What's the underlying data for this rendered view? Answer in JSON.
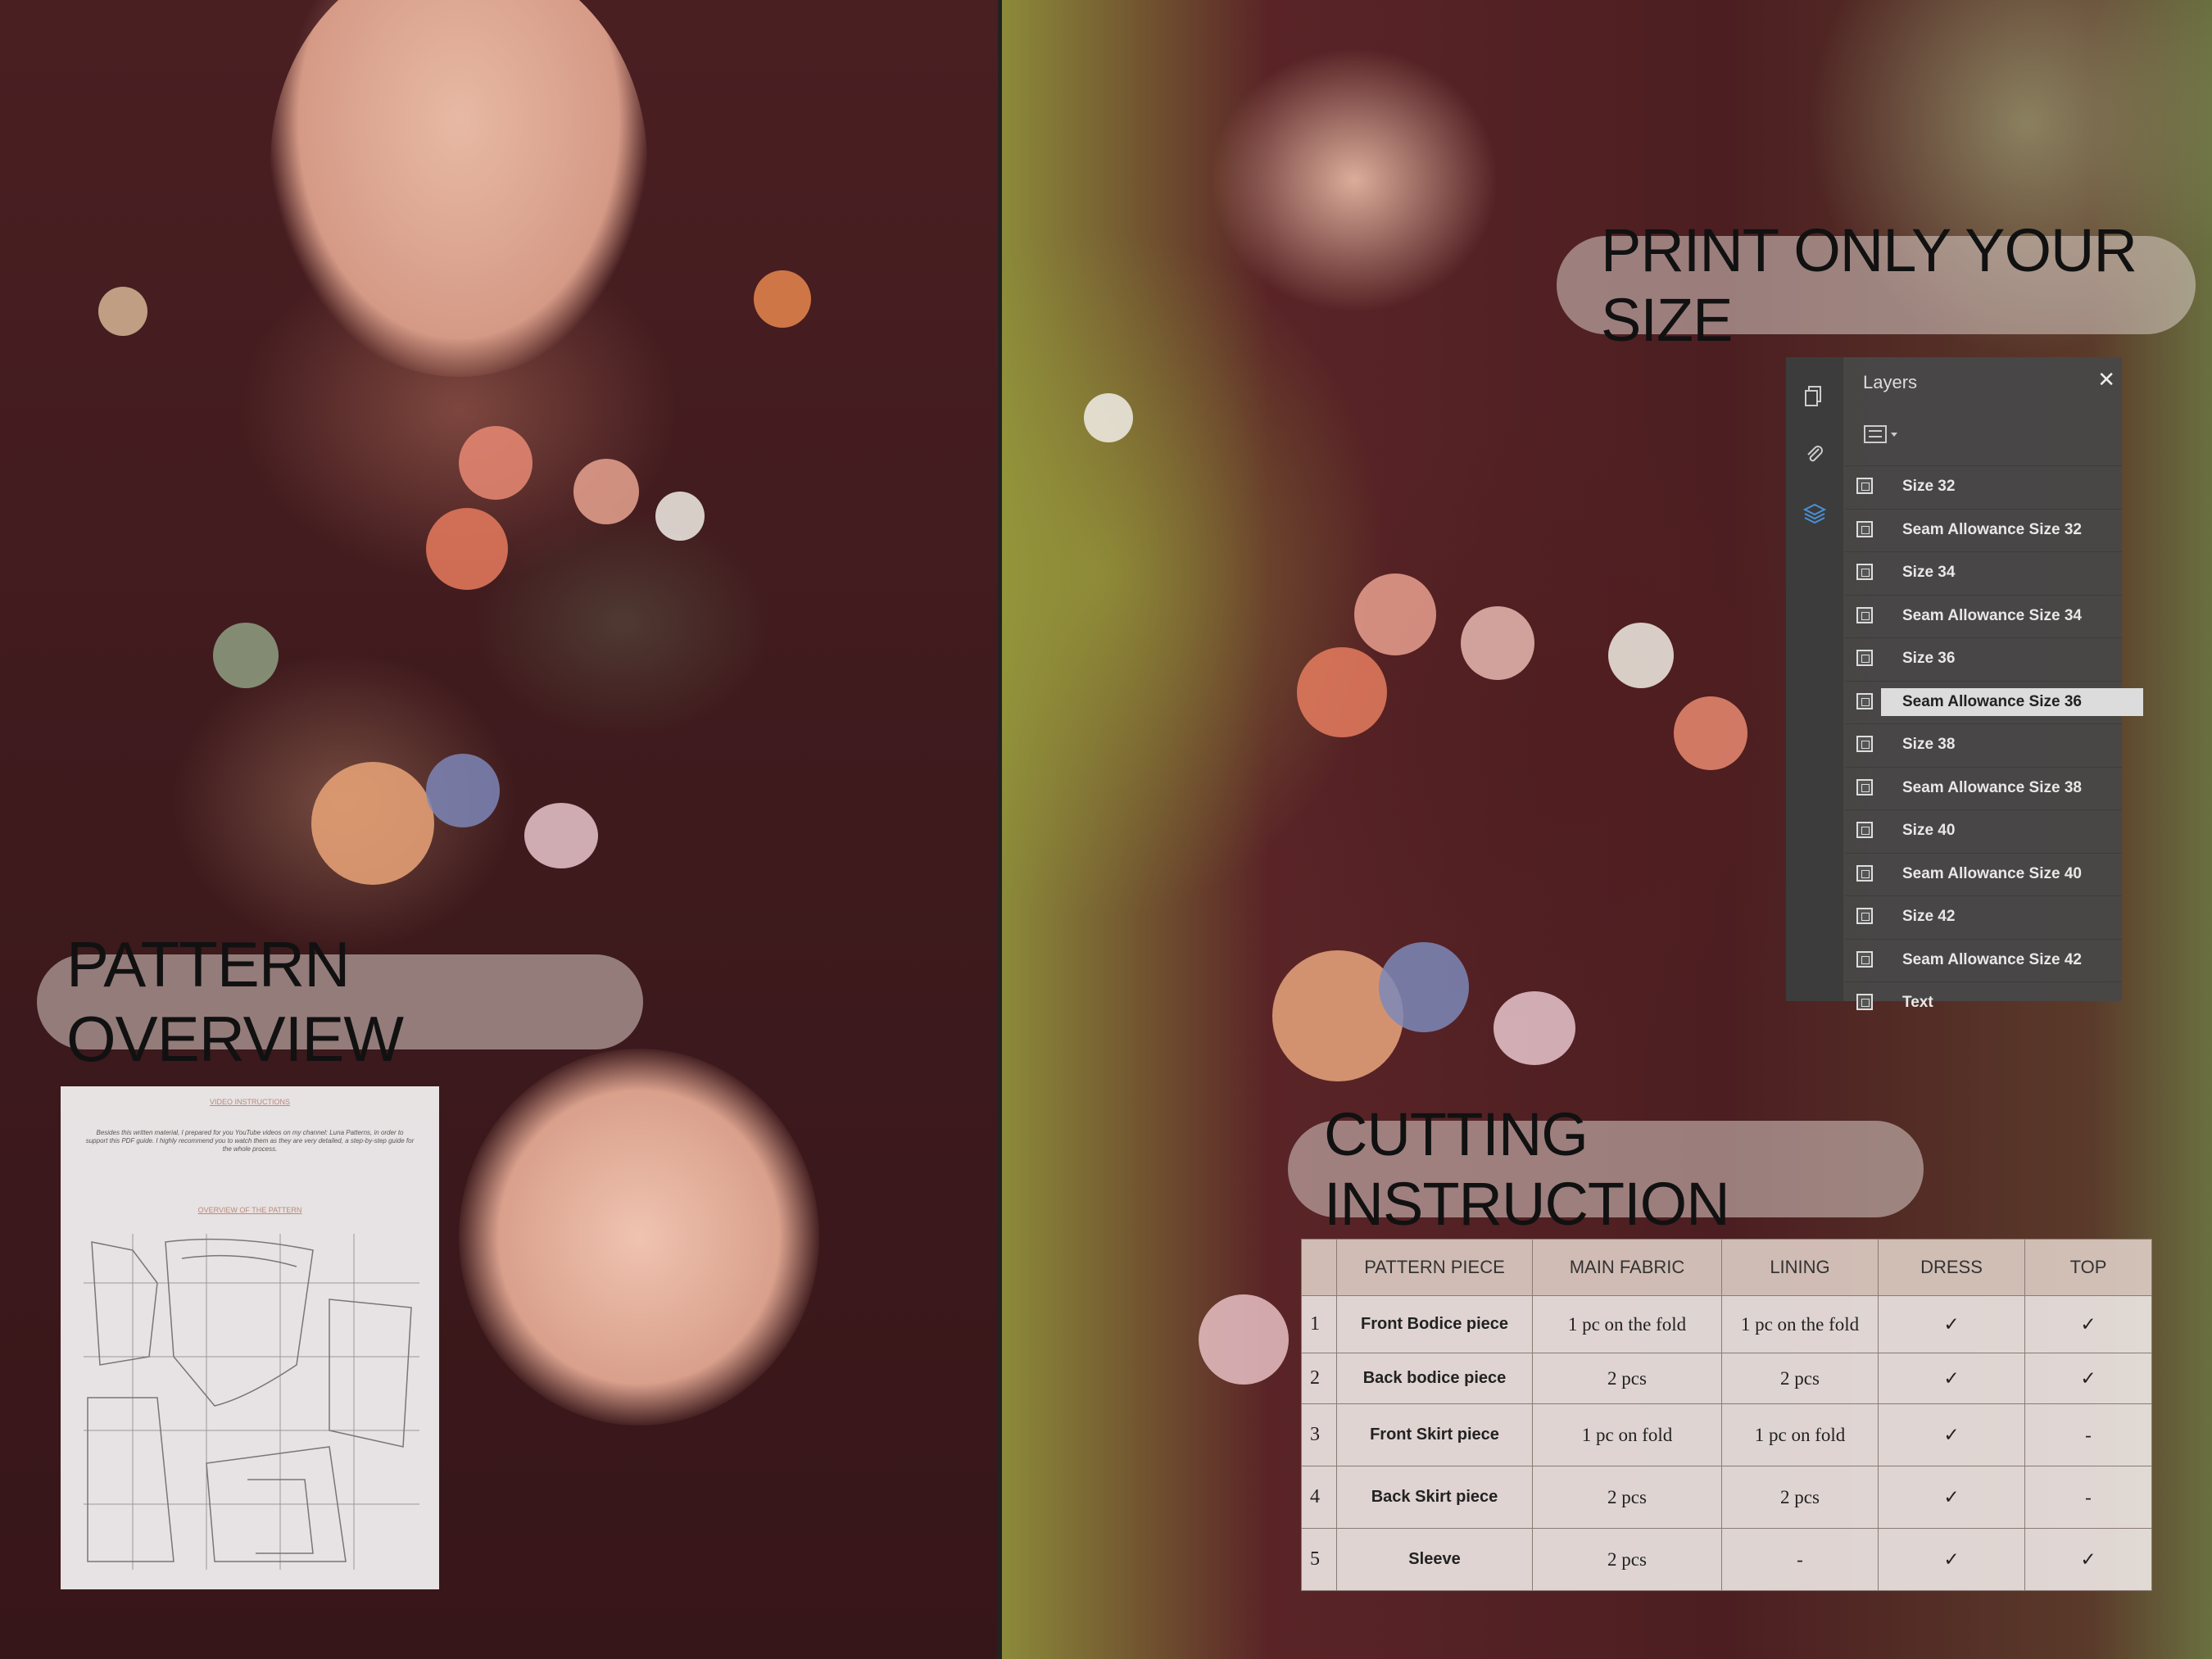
{
  "headings": {
    "pattern_overview": "PATTERN OVERVIEW",
    "print_only": "PRINT ONLY YOUR SIZE",
    "cutting_instruction": "CUTTING INSTRUCTION"
  },
  "pattern_page": {
    "video_heading": "VIDEO INSTRUCTIONS",
    "body": "Besides this written material, I prepared for you YouTube videos on my channel: Luna Patterns, in order to support this PDF guide. I highly recommend you to watch them as they are very detailed, a step-by-step guide for the whole process.",
    "overview_heading": "OVERVIEW OF THE PATTERN"
  },
  "layers_panel": {
    "title": "Layers",
    "close": "✕",
    "rail_icons": [
      "pages-icon",
      "attachment-icon",
      "layers-icon"
    ],
    "items": [
      {
        "label": "Size 32",
        "active": false
      },
      {
        "label": "Seam Allowance Size 32",
        "active": false
      },
      {
        "label": "Size 34",
        "active": false
      },
      {
        "label": "Seam Allowance Size 34",
        "active": false
      },
      {
        "label": "Size 36",
        "active": false
      },
      {
        "label": "Seam Allowance Size 36",
        "active": true
      },
      {
        "label": "Size 38",
        "active": false
      },
      {
        "label": "Seam Allowance Size 38",
        "active": false
      },
      {
        "label": "Size 40",
        "active": false
      },
      {
        "label": "Seam Allowance Size 40",
        "active": false
      },
      {
        "label": "Size 42",
        "active": false
      },
      {
        "label": "Seam Allowance Size 42",
        "active": false
      },
      {
        "label": "Text",
        "active": false
      }
    ]
  },
  "cutting_table": {
    "headers": [
      "",
      "PATTERN PIECE",
      "MAIN FABRIC",
      "LINING",
      "DRESS",
      "TOP"
    ],
    "rows": [
      [
        "1",
        "Front Bodice piece",
        "1 pc on the fold",
        "1 pc on the fold",
        "✓",
        "✓"
      ],
      [
        "2",
        "Back bodice piece",
        "2 pcs",
        "2 pcs",
        "✓",
        "✓"
      ],
      [
        "3",
        "Front Skirt piece",
        "1 pc on fold",
        "1 pc on fold",
        "✓",
        "-"
      ],
      [
        "4",
        "Back Skirt piece",
        "2 pcs",
        "2 pcs",
        "✓",
        "-"
      ],
      [
        "5",
        "Sleeve",
        "2 pcs",
        "-",
        "✓",
        "✓"
      ]
    ]
  },
  "colors": {
    "fabric": "#4a1f22",
    "panel_bg": "#484848",
    "active_layer": "#dcdcdc",
    "layers_icon": "#4a90d9"
  }
}
